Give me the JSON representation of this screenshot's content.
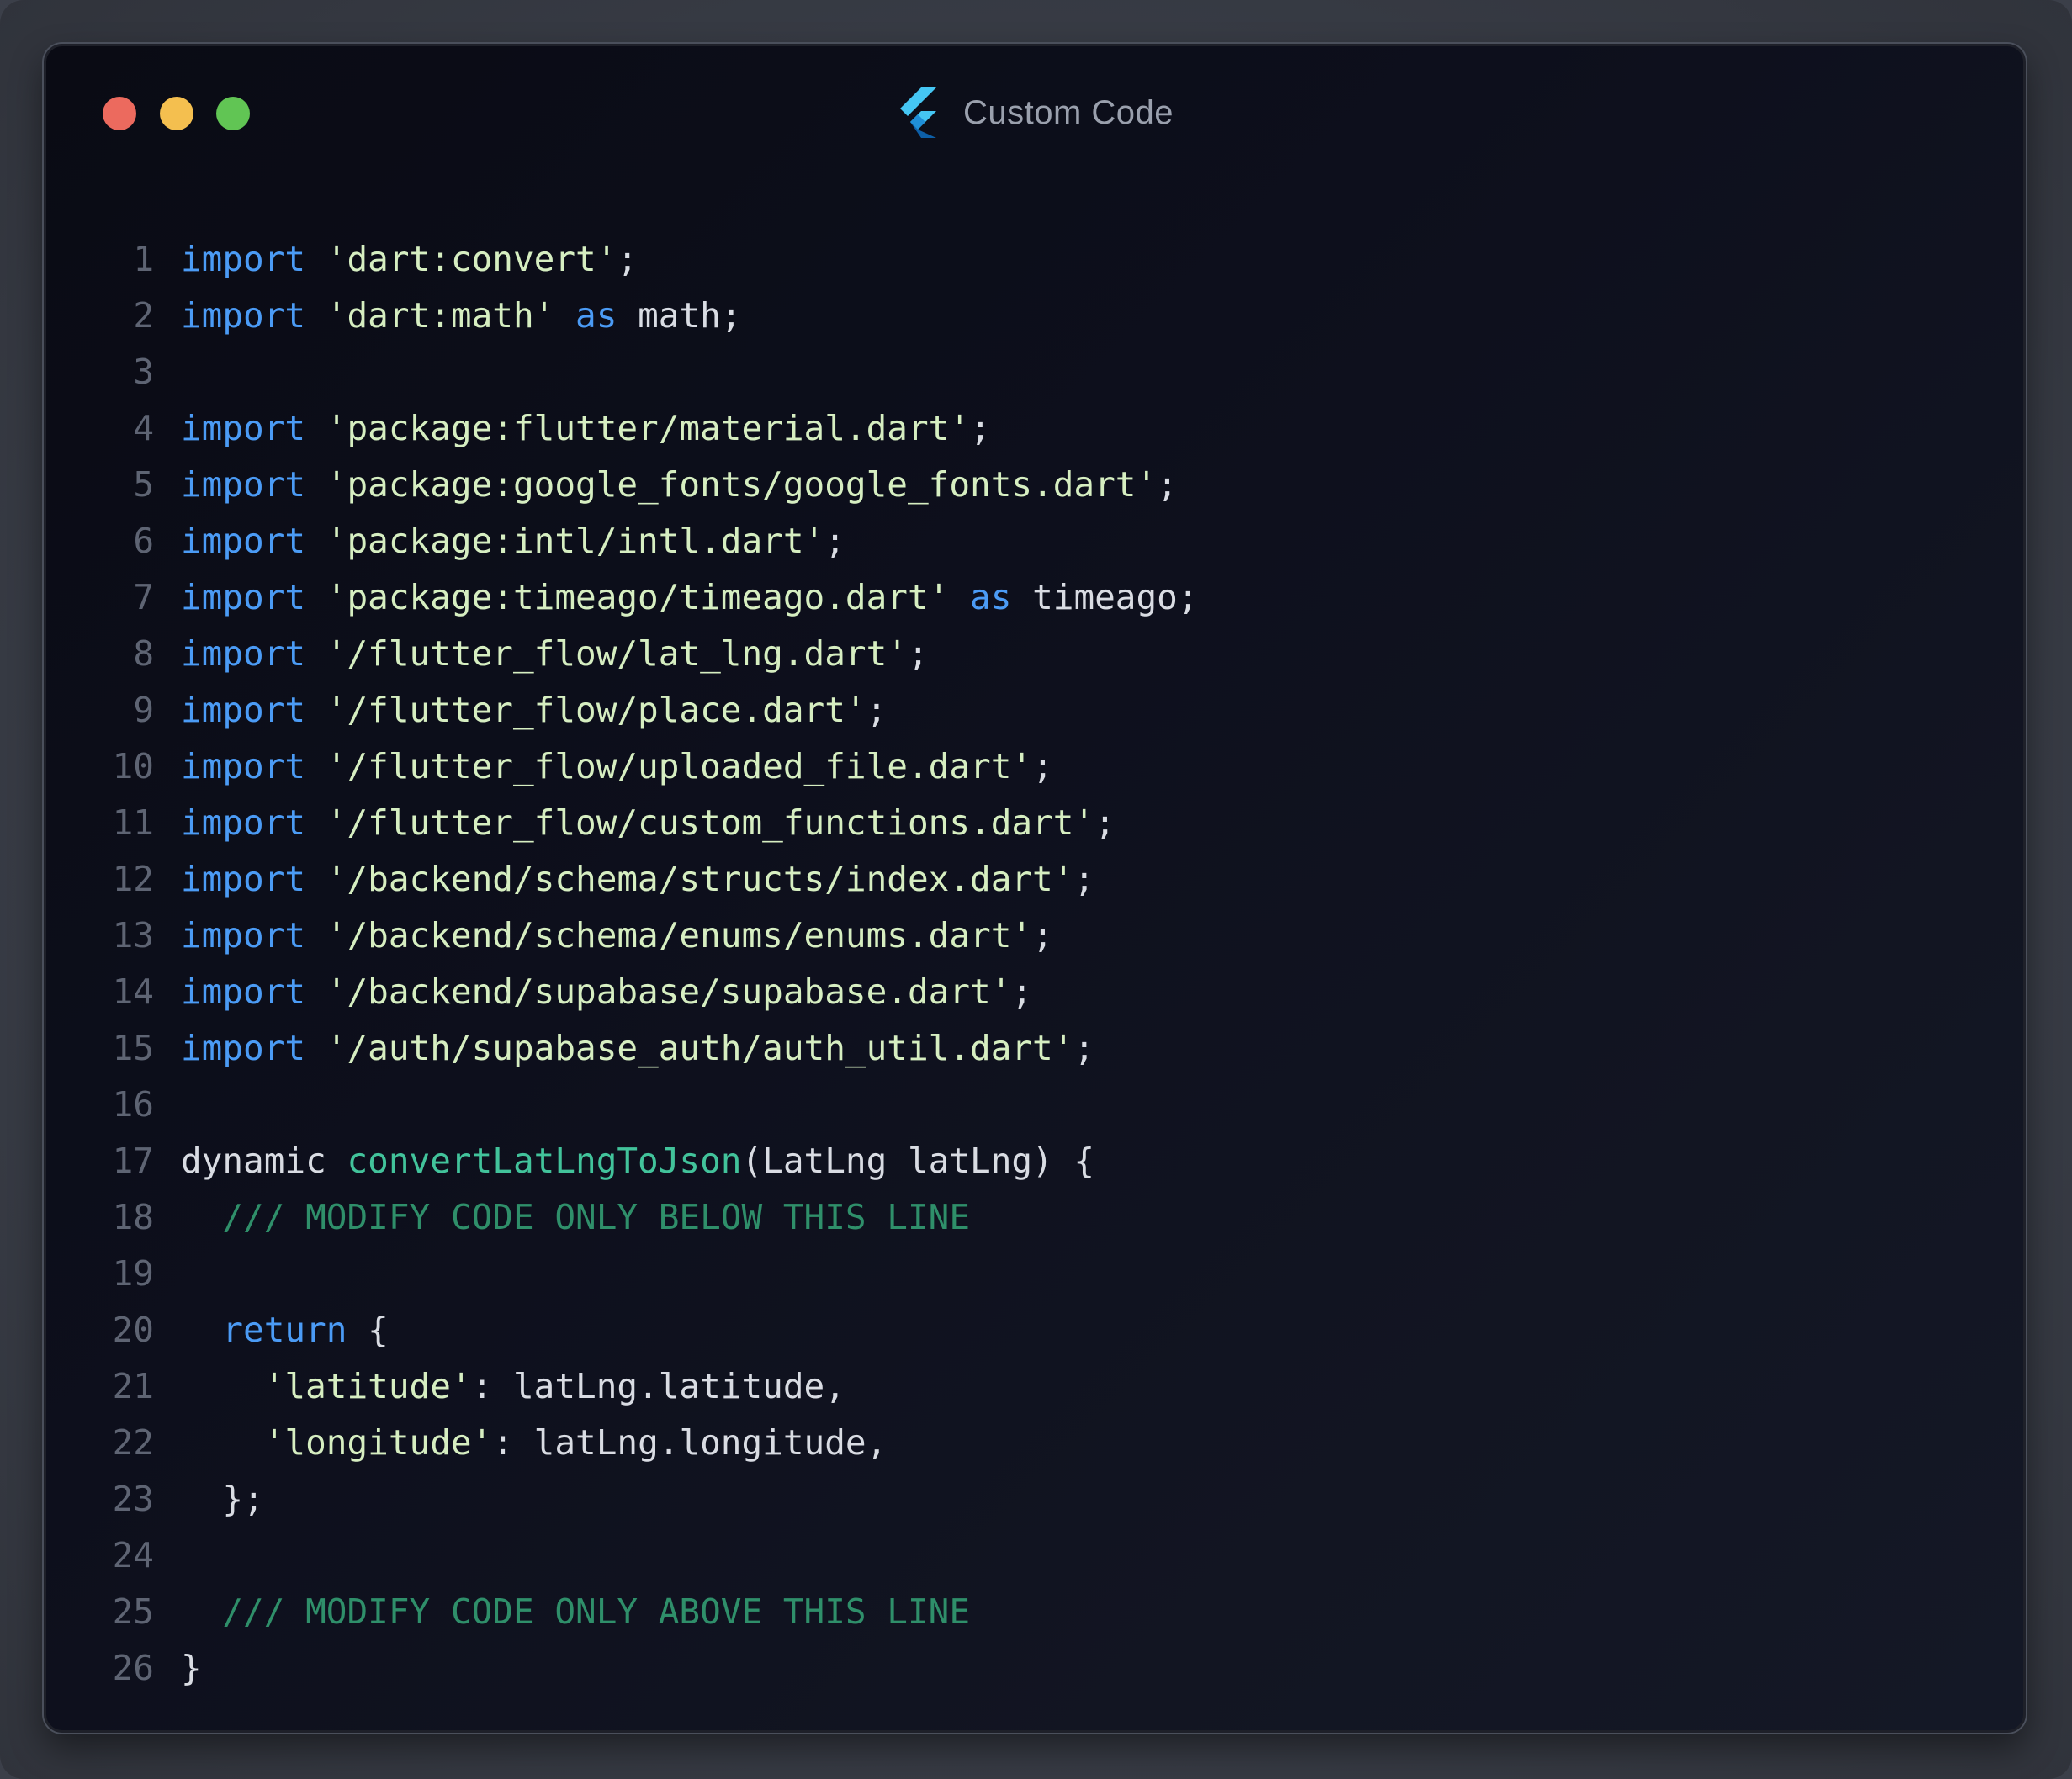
{
  "window": {
    "title": "Custom Code",
    "app_icon": "flutter-logo-icon",
    "traffic_lights": [
      {
        "name": "close-button",
        "color": "#ec6a5e"
      },
      {
        "name": "minimize-button",
        "color": "#f4bf4f"
      },
      {
        "name": "maximize-button",
        "color": "#61c554"
      }
    ]
  },
  "theme": {
    "keyword": "#4b9bf5",
    "string": "#d6eec1",
    "function": "#42c39b",
    "comment": "#2f8f6a",
    "plain": "#d9dce3",
    "line_number": "#5e6473",
    "background": "#0d0f1c"
  },
  "code": {
    "lines": [
      {
        "n": "1",
        "tokens": [
          {
            "t": "kw",
            "v": "import"
          },
          {
            "t": "pl",
            "v": " "
          },
          {
            "t": "str",
            "v": "'dart:convert'"
          },
          {
            "t": "pl",
            "v": ";"
          }
        ]
      },
      {
        "n": "2",
        "tokens": [
          {
            "t": "kw",
            "v": "import"
          },
          {
            "t": "pl",
            "v": " "
          },
          {
            "t": "str",
            "v": "'dart:math'"
          },
          {
            "t": "pl",
            "v": " "
          },
          {
            "t": "kw",
            "v": "as"
          },
          {
            "t": "pl",
            "v": " math;"
          }
        ]
      },
      {
        "n": "3",
        "tokens": []
      },
      {
        "n": "4",
        "tokens": [
          {
            "t": "kw",
            "v": "import"
          },
          {
            "t": "pl",
            "v": " "
          },
          {
            "t": "str",
            "v": "'package:flutter/material.dart'"
          },
          {
            "t": "pl",
            "v": ";"
          }
        ]
      },
      {
        "n": "5",
        "tokens": [
          {
            "t": "kw",
            "v": "import"
          },
          {
            "t": "pl",
            "v": " "
          },
          {
            "t": "str",
            "v": "'package:google_fonts/google_fonts.dart'"
          },
          {
            "t": "pl",
            "v": ";"
          }
        ]
      },
      {
        "n": "6",
        "tokens": [
          {
            "t": "kw",
            "v": "import"
          },
          {
            "t": "pl",
            "v": " "
          },
          {
            "t": "str",
            "v": "'package:intl/intl.dart'"
          },
          {
            "t": "pl",
            "v": ";"
          }
        ]
      },
      {
        "n": "7",
        "tokens": [
          {
            "t": "kw",
            "v": "import"
          },
          {
            "t": "pl",
            "v": " "
          },
          {
            "t": "str",
            "v": "'package:timeago/timeago.dart'"
          },
          {
            "t": "pl",
            "v": " "
          },
          {
            "t": "kw",
            "v": "as"
          },
          {
            "t": "pl",
            "v": " timeago;"
          }
        ]
      },
      {
        "n": "8",
        "tokens": [
          {
            "t": "kw",
            "v": "import"
          },
          {
            "t": "pl",
            "v": " "
          },
          {
            "t": "str",
            "v": "'/flutter_flow/lat_lng.dart'"
          },
          {
            "t": "pl",
            "v": ";"
          }
        ]
      },
      {
        "n": "9",
        "tokens": [
          {
            "t": "kw",
            "v": "import"
          },
          {
            "t": "pl",
            "v": " "
          },
          {
            "t": "str",
            "v": "'/flutter_flow/place.dart'"
          },
          {
            "t": "pl",
            "v": ";"
          }
        ]
      },
      {
        "n": "10",
        "tokens": [
          {
            "t": "kw",
            "v": "import"
          },
          {
            "t": "pl",
            "v": " "
          },
          {
            "t": "str",
            "v": "'/flutter_flow/uploaded_file.dart'"
          },
          {
            "t": "pl",
            "v": ";"
          }
        ]
      },
      {
        "n": "11",
        "tokens": [
          {
            "t": "kw",
            "v": "import"
          },
          {
            "t": "pl",
            "v": " "
          },
          {
            "t": "str",
            "v": "'/flutter_flow/custom_functions.dart'"
          },
          {
            "t": "pl",
            "v": ";"
          }
        ]
      },
      {
        "n": "12",
        "tokens": [
          {
            "t": "kw",
            "v": "import"
          },
          {
            "t": "pl",
            "v": " "
          },
          {
            "t": "str",
            "v": "'/backend/schema/structs/index.dart'"
          },
          {
            "t": "pl",
            "v": ";"
          }
        ]
      },
      {
        "n": "13",
        "tokens": [
          {
            "t": "kw",
            "v": "import"
          },
          {
            "t": "pl",
            "v": " "
          },
          {
            "t": "str",
            "v": "'/backend/schema/enums/enums.dart'"
          },
          {
            "t": "pl",
            "v": ";"
          }
        ]
      },
      {
        "n": "14",
        "tokens": [
          {
            "t": "kw",
            "v": "import"
          },
          {
            "t": "pl",
            "v": " "
          },
          {
            "t": "str",
            "v": "'/backend/supabase/supabase.dart'"
          },
          {
            "t": "pl",
            "v": ";"
          }
        ]
      },
      {
        "n": "15",
        "tokens": [
          {
            "t": "kw",
            "v": "import"
          },
          {
            "t": "pl",
            "v": " "
          },
          {
            "t": "str",
            "v": "'/auth/supabase_auth/auth_util.dart'"
          },
          {
            "t": "pl",
            "v": ";"
          }
        ]
      },
      {
        "n": "16",
        "tokens": []
      },
      {
        "n": "17",
        "tokens": [
          {
            "t": "pl",
            "v": "dynamic "
          },
          {
            "t": "fn",
            "v": "convertLatLngToJson"
          },
          {
            "t": "pl",
            "v": "(LatLng latLng) {"
          }
        ]
      },
      {
        "n": "18",
        "tokens": [
          {
            "t": "pl",
            "v": "  "
          },
          {
            "t": "cm",
            "v": "/// MODIFY CODE ONLY BELOW THIS LINE"
          }
        ]
      },
      {
        "n": "19",
        "tokens": []
      },
      {
        "n": "20",
        "tokens": [
          {
            "t": "pl",
            "v": "  "
          },
          {
            "t": "kw",
            "v": "return"
          },
          {
            "t": "pl",
            "v": " {"
          }
        ]
      },
      {
        "n": "21",
        "tokens": [
          {
            "t": "pl",
            "v": "    "
          },
          {
            "t": "str",
            "v": "'latitude'"
          },
          {
            "t": "pl",
            "v": ": latLng.latitude,"
          }
        ]
      },
      {
        "n": "22",
        "tokens": [
          {
            "t": "pl",
            "v": "    "
          },
          {
            "t": "str",
            "v": "'longitude'"
          },
          {
            "t": "pl",
            "v": ": latLng.longitude,"
          }
        ]
      },
      {
        "n": "23",
        "tokens": [
          {
            "t": "pl",
            "v": "  };"
          }
        ]
      },
      {
        "n": "24",
        "tokens": []
      },
      {
        "n": "25",
        "tokens": [
          {
            "t": "pl",
            "v": "  "
          },
          {
            "t": "cm",
            "v": "/// MODIFY CODE ONLY ABOVE THIS LINE"
          }
        ]
      },
      {
        "n": "26",
        "tokens": [
          {
            "t": "pl",
            "v": "}"
          }
        ]
      }
    ]
  }
}
